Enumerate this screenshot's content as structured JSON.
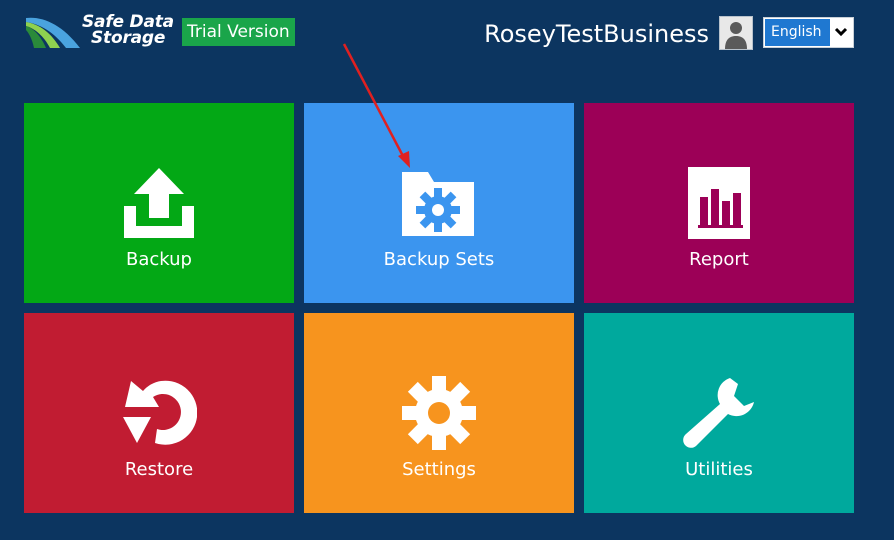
{
  "header": {
    "logo": {
      "line1": "Safe Data",
      "line2": "Storage"
    },
    "badge": "Trial Version",
    "user_name": "RoseyTestBusiness",
    "language": {
      "selected": "English"
    }
  },
  "tiles": [
    {
      "label": "Backup",
      "color": "#03a815",
      "icon": "upload-icon"
    },
    {
      "label": "Backup Sets",
      "color": "#3b95ef",
      "icon": "folder-gear-icon"
    },
    {
      "label": "Report",
      "color": "#9c0057",
      "icon": "bar-chart-icon"
    },
    {
      "label": "Restore",
      "color": "#c11c32",
      "icon": "restore-arrow-icon"
    },
    {
      "label": "Settings",
      "color": "#f7941e",
      "icon": "gear-icon"
    },
    {
      "label": "Utilities",
      "color": "#00a99d",
      "icon": "wrench-icon"
    }
  ],
  "annotation": {
    "arrow_color": "#e02020"
  }
}
